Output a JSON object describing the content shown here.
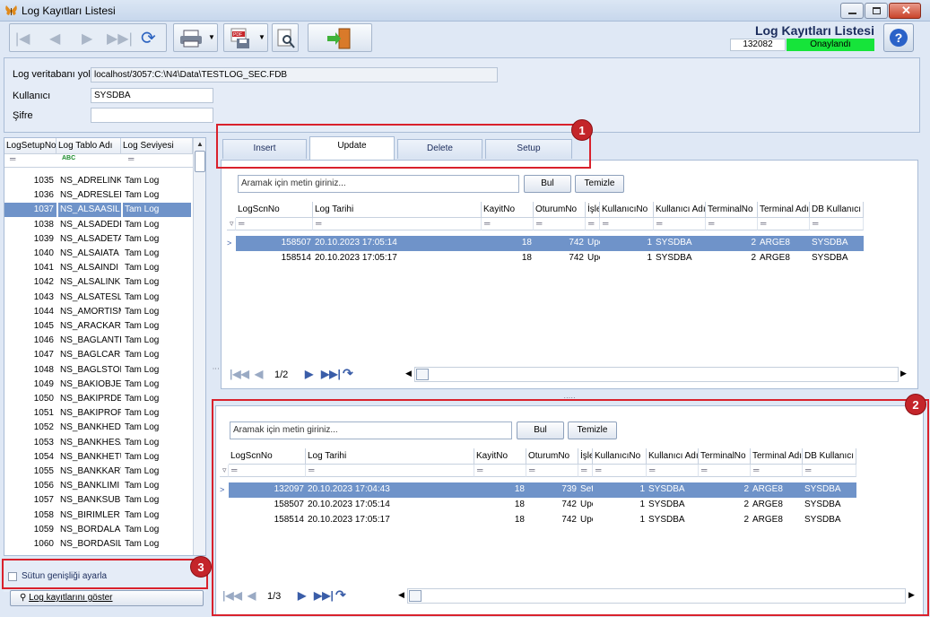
{
  "window": {
    "title": "Log Kayıtları Listesi"
  },
  "header": {
    "title": "Log Kayıtları Listesi",
    "record_id": "132082",
    "status": "Onaylandı"
  },
  "info": {
    "db_path_label": "Log veritabanı yolu",
    "db_path_value": "localhost/3057:C:\\N4\\Data\\TESTLOG_SEC.FDB",
    "user_label": "Kullanıcı",
    "user_value": "SYSDBA",
    "password_label": "Şifre",
    "password_value": ""
  },
  "left_grid": {
    "columns": [
      "LogSetupNo",
      "Log Tablo Adı",
      "Log Seviyesi"
    ],
    "rows": [
      [
        "1035",
        "NS_ADRELINK",
        "Tam Log"
      ],
      [
        "1036",
        "NS_ADRESLER",
        "Tam Log"
      ],
      [
        "1037",
        "NS_ALSAASIL",
        "Tam Log"
      ],
      [
        "1038",
        "NS_ALSADEDE",
        "Tam Log"
      ],
      [
        "1039",
        "NS_ALSADETA",
        "Tam Log"
      ],
      [
        "1040",
        "NS_ALSAIATA",
        "Tam Log"
      ],
      [
        "1041",
        "NS_ALSAINDI",
        "Tam Log"
      ],
      [
        "1042",
        "NS_ALSALINK",
        "Tam Log"
      ],
      [
        "1043",
        "NS_ALSATESL",
        "Tam Log"
      ],
      [
        "1044",
        "NS_AMORTISM",
        "Tam Log"
      ],
      [
        "1045",
        "NS_ARACKART",
        "Tam Log"
      ],
      [
        "1046",
        "NS_BAGLANTI",
        "Tam Log"
      ],
      [
        "1047",
        "NS_BAGLCARI",
        "Tam Log"
      ],
      [
        "1048",
        "NS_BAGLSTOK",
        "Tam Log"
      ],
      [
        "1049",
        "NS_BAKIOBJE",
        "Tam Log"
      ],
      [
        "1050",
        "NS_BAKIPRDE",
        "Tam Log"
      ],
      [
        "1051",
        "NS_BAKIPROF",
        "Tam Log"
      ],
      [
        "1052",
        "NS_BANKHEDE",
        "Tam Log"
      ],
      [
        "1053",
        "NS_BANKHESA",
        "Tam Log"
      ],
      [
        "1054",
        "NS_BANKHETU",
        "Tam Log"
      ],
      [
        "1055",
        "NS_BANKKART",
        "Tam Log"
      ],
      [
        "1056",
        "NS_BANKLIMI",
        "Tam Log"
      ],
      [
        "1057",
        "NS_BANKSUBE",
        "Tam Log"
      ],
      [
        "1058",
        "NS_BIRIMLER",
        "Tam Log"
      ],
      [
        "1059",
        "NS_BORDALAN",
        "Tam Log"
      ],
      [
        "1060",
        "NS_BORDASIL",
        "Tam Log"
      ]
    ],
    "selected_index": 2
  },
  "left_bottom": {
    "checkbox_label": "Sütun genişliği ayarla",
    "show_logs_label": "Log kayıtlarını göster"
  },
  "tabs": [
    "Insert",
    "Update",
    "Delete",
    "Setup"
  ],
  "active_tab": 1,
  "search": {
    "placeholder": "Aramak için metin giriniz...",
    "find": "Bul",
    "clear": "Temizle"
  },
  "log_columns": [
    "LogScnNo",
    "Log Tarihi",
    "KayitNo",
    "OturumNo",
    "İşle",
    "KullanıcıNo",
    "Kullanıcı Adı",
    "TerminalNo",
    "Terminal Adı",
    "DB Kullanıcı"
  ],
  "upper_grid": {
    "rows": [
      [
        "158507",
        "20.10.2023 17:05:14",
        "18",
        "742",
        "Upc",
        "1",
        "SYSDBA",
        "2",
        "ARGE8",
        "SYSDBA"
      ],
      [
        "158514",
        "20.10.2023 17:05:17",
        "18",
        "742",
        "Upc",
        "1",
        "SYSDBA",
        "2",
        "ARGE8",
        "SYSDBA"
      ]
    ],
    "page": "1/2"
  },
  "lower_grid": {
    "rows": [
      [
        "132097",
        "20.10.2023 17:04:43",
        "18",
        "739",
        "Set",
        "1",
        "SYSDBA",
        "2",
        "ARGE8",
        "SYSDBA"
      ],
      [
        "158507",
        "20.10.2023 17:05:14",
        "18",
        "742",
        "Upc",
        "1",
        "SYSDBA",
        "2",
        "ARGE8",
        "SYSDBA"
      ],
      [
        "158514",
        "20.10.2023 17:05:17",
        "18",
        "742",
        "Upc",
        "1",
        "SYSDBA",
        "2",
        "ARGE8",
        "SYSDBA"
      ]
    ],
    "page": "1/3"
  },
  "annotations": [
    "1",
    "2",
    "3"
  ],
  "colors": {
    "selected_row": "#6f93c9",
    "status_green": "#16e43a",
    "annotation_red": "#d9212c"
  }
}
